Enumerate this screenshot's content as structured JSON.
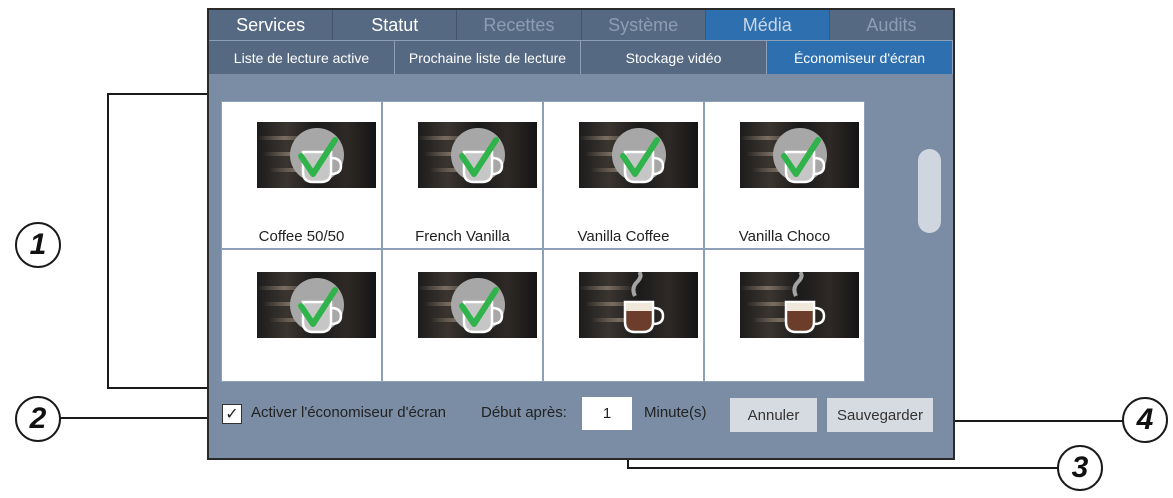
{
  "tabs_top": [
    {
      "label": "Services",
      "state": "normal"
    },
    {
      "label": "Statut",
      "state": "normal"
    },
    {
      "label": "Recettes",
      "state": "disabled"
    },
    {
      "label": "Système",
      "state": "disabled"
    },
    {
      "label": "Média",
      "state": "active"
    },
    {
      "label": "Audits",
      "state": "disabled"
    }
  ],
  "tabs_sub": [
    {
      "label": "Liste de lecture active",
      "state": "normal"
    },
    {
      "label": "Prochaine liste de lecture",
      "state": "normal"
    },
    {
      "label": "Stockage vidéo",
      "state": "normal"
    },
    {
      "label": "Économiseur d'écran",
      "state": "active"
    }
  ],
  "tiles": [
    {
      "label": "Coffee 50/50",
      "selected": true,
      "icon": "coffee-cup-check-icon"
    },
    {
      "label": "French Vanilla",
      "selected": true,
      "icon": "coffee-cup-check-icon"
    },
    {
      "label": "Vanilla Coffee",
      "selected": true,
      "icon": "coffee-cup-check-icon"
    },
    {
      "label": "Vanilla Choco",
      "selected": true,
      "icon": "coffee-cup-check-icon"
    },
    {
      "label": "",
      "selected": true,
      "icon": "coffee-cup-check-icon"
    },
    {
      "label": "",
      "selected": true,
      "icon": "coffee-cup-check-icon"
    },
    {
      "label": "",
      "selected": false,
      "icon": "coffee-cup-icon"
    },
    {
      "label": "",
      "selected": false,
      "icon": "coffee-cup-icon"
    }
  ],
  "bottom": {
    "checkbox_checked": true,
    "checkbox_mark": "✓",
    "activate_label": "Activer l'économiseur d'écran",
    "start_after_label": "Début après:",
    "minutes_value": "1",
    "minutes_unit": "Minute(s)",
    "cancel_label": "Annuler",
    "save_label": "Sauvegarder"
  },
  "callouts": [
    "1",
    "2",
    "3",
    "4"
  ],
  "colors": {
    "panel_bg": "#7b8da5",
    "tab_bg": "#566982",
    "tab_active": "#2e6fb0",
    "check_green": "#2fb34a"
  }
}
